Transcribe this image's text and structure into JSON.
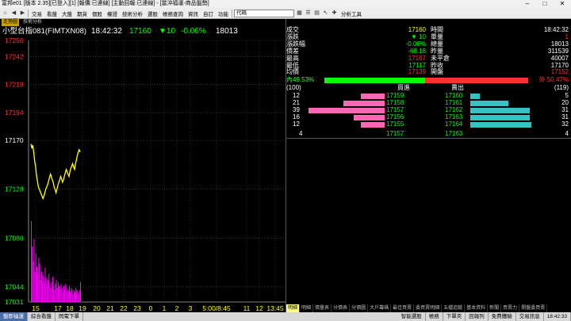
{
  "window": {
    "title": "富邦e01 [版本 2.35][已登入][1] [報價:已連線] [主動回報:已連線] - [當沖福運-商品盤勢]"
  },
  "toolbar": {
    "menus": [
      "交易",
      "看盤",
      "大盤",
      "期貨",
      "個股",
      "權證",
      "技術分析",
      "選股",
      "帳務查詢",
      "資訊",
      "自訂",
      "功能"
    ],
    "combo_value": "代碼",
    "tools_label": "分析工具"
  },
  "tabs": [
    {
      "label": "走勢圖",
      "active": true
    },
    {
      "label": "技術分析",
      "active": false
    }
  ],
  "info": {
    "product": "小型台指081(FIMTXN08)",
    "time": "18:42:32",
    "price": "17160",
    "change": "▼10",
    "pct": "-0.06%",
    "volume": "18013"
  },
  "colors": {
    "price_line": "#ffff00",
    "volume": "#ff00ff",
    "up": "#ff3030",
    "down": "#00ff00",
    "flat": "#ffff00",
    "bid_bar": "#ff66b4",
    "ask_bar": "#33c3c3"
  },
  "chart_data": {
    "type": "line",
    "y_ticks": [
      "17256",
      "17242",
      "17218",
      "17194",
      "17170",
      "17128",
      "17086",
      "17044",
      "17031"
    ],
    "x_ticks": [
      "15",
      "17",
      "18",
      "19",
      "20",
      "21",
      "22",
      "23",
      "0",
      "1",
      "2",
      "3",
      "5:00/8:45",
      "11",
      "12",
      "13:45"
    ],
    "ylim": [
      17031,
      17256
    ],
    "reference": 17170,
    "series": [
      {
        "values": [
          17167,
          17163,
          17166,
          17160,
          17152,
          17148,
          17140,
          17135,
          17130,
          17128,
          17126,
          17124,
          17122,
          17120,
          17122,
          17125,
          17128,
          17130,
          17132,
          17135,
          17138,
          17141,
          17139,
          17136,
          17134,
          17130,
          17128,
          17125,
          17128,
          17131,
          17134,
          17136,
          17139,
          17137,
          17134,
          17136,
          17139,
          17142,
          17145,
          17143,
          17141,
          17139,
          17143,
          17146,
          17148,
          17150,
          17147,
          17145,
          17150,
          17153,
          17157,
          17160,
          17162,
          17160
        ]
      }
    ],
    "volume": [
      80,
      55,
      40,
      62,
      30,
      48,
      35,
      28,
      44,
      38,
      22,
      30,
      18,
      26,
      20,
      34,
      24,
      16,
      22,
      28,
      18,
      14,
      20,
      25,
      16,
      12,
      18,
      22,
      14,
      20,
      16,
      12,
      18,
      14,
      10,
      16,
      12,
      18,
      14,
      10,
      12,
      16,
      10,
      14,
      12,
      8,
      12,
      10,
      14,
      12,
      10,
      8,
      12,
      20
    ]
  },
  "quote": {
    "left_labels": [
      "成交",
      "漲跌",
      "漲跌幅",
      "價差",
      "最高",
      "最低",
      "均價"
    ],
    "left_values": [
      "17160",
      "▼ 10",
      "-0.06%",
      "-68.18",
      "17167",
      "17117",
      "17139"
    ],
    "right_labels": [
      "時間",
      "單量",
      "總量",
      "昨量",
      "未平倉",
      "昨收",
      "開盤"
    ],
    "right_values": [
      "18:42:32",
      "1",
      "18013",
      "311539",
      "40007",
      "17170",
      "17152"
    ],
    "inner_label": "內49.53%",
    "outer_label": "外 50.47%",
    "inner_ratio": 0.4953,
    "bid_total": "(100)",
    "ask_total": "(119)",
    "bid_header": "買進",
    "ask_header": "賣出",
    "bids": [
      {
        "vol": "12",
        "price": "17159"
      },
      {
        "vol": "21",
        "price": "17158"
      },
      {
        "vol": "39",
        "price": "17157"
      },
      {
        "vol": "16",
        "price": "17156"
      },
      {
        "vol": "12",
        "price": "17155"
      }
    ],
    "asks": [
      {
        "price": "17160",
        "vol": "5"
      },
      {
        "price": "17161",
        "vol": "20"
      },
      {
        "price": "17162",
        "vol": "31"
      },
      {
        "price": "17163",
        "vol": "31"
      },
      {
        "price": "17164",
        "vol": "32"
      }
    ],
    "last_bid_vol": "4",
    "last_bid_price": "17157",
    "last_ask_price": "17163",
    "last_ask_vol": "4"
  },
  "bottom_tabs": [
    "明細",
    "明細",
    "價量表",
    "分價表",
    "分價圖",
    "大戶籌碼",
    "最佳買賣",
    "委買賣明細",
    "五檔追蹤",
    "基本資料",
    "新聞",
    "買賣力",
    "開盤委買賣"
  ],
  "status": {
    "items": [
      "盤即福運",
      "綜合看盤",
      "閃電下單"
    ],
    "right_items": [
      "智能選股",
      "帳務",
      "下單夾",
      "回報列",
      "免費體驗",
      "交易訊息"
    ],
    "time": "18:42:33"
  }
}
